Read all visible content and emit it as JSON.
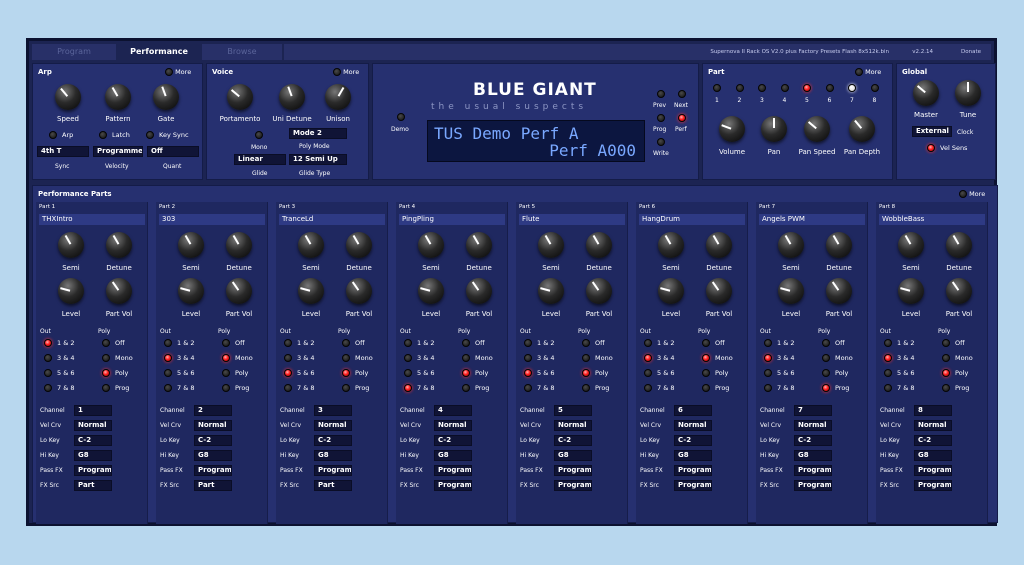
{
  "tabs": [
    "Program",
    "Performance",
    "Browse"
  ],
  "info": {
    "title": "Supernova II Rack OS V2.0 plus Factory Presets Flash 8x512k.bin",
    "version": "v2.2.14",
    "donate": "Donate"
  },
  "arp": {
    "title": "Arp",
    "more": "More",
    "knobs": [
      "Speed",
      "Pattern",
      "Gate"
    ],
    "toggles": [
      "Arp",
      "Latch",
      "Key Sync"
    ],
    "sync": "4th T",
    "sync_label": "Sync",
    "velocity": "Programmed",
    "velocity_label": "Velocity",
    "quant": "Off",
    "quant_label": "Quant"
  },
  "voice": {
    "title": "Voice",
    "more": "More",
    "knobs": [
      "Portamento",
      "Uni Detune",
      "Unison"
    ],
    "mono": "Mono",
    "poly_mode": "Mode 2",
    "poly_mode_label": "Poly Mode",
    "glide": "Linear",
    "glide_label": "Glide",
    "glide_type": "12 Semi Up",
    "glide_type_label": "Glide Type"
  },
  "display": {
    "brand": "BLUE GIANT",
    "subtitle": "the usual suspects",
    "demo": "Demo",
    "line1": "TUS Demo Perf A",
    "line2": "Perf A000",
    "prev": "Prev",
    "next": "Next",
    "prog": "Prog",
    "perf": "Perf",
    "write": "Write"
  },
  "part": {
    "title": "Part",
    "more": "More",
    "numbers": [
      "1",
      "2",
      "3",
      "4",
      "5",
      "6",
      "7",
      "8"
    ],
    "knobs": [
      "Volume",
      "Pan",
      "Pan Speed",
      "Pan Depth"
    ]
  },
  "global": {
    "title": "Global",
    "knobs": [
      "Master",
      "Tune"
    ],
    "clock_value": "External",
    "clock_label": "Clock",
    "vel_sens": "Vel Sens"
  },
  "perf_parts": {
    "title": "Performance Parts",
    "more": "More",
    "out_label": "Out",
    "poly_label": "Poly",
    "outs": [
      "1 & 2",
      "3 & 4",
      "5 & 6",
      "7 & 8"
    ],
    "polys": [
      "Off",
      "Mono",
      "Poly",
      "Prog"
    ],
    "knob_labels": [
      "Semi",
      "Detune",
      "Level",
      "Part Vol"
    ],
    "field_labels": [
      "Channel",
      "Vel Crv",
      "Lo Key",
      "Hi Key",
      "Pass FX",
      "FX Src"
    ],
    "parts": [
      {
        "hdr": "Part 1",
        "name": "THXIntro",
        "channel": "1",
        "vel": "Normal",
        "lo": "C-2",
        "hi": "G8",
        "pass": "Program (",
        "fxsrc": "Part",
        "out": 0,
        "poly": 2
      },
      {
        "hdr": "Part 2",
        "name": "303",
        "channel": "2",
        "vel": "Normal",
        "lo": "C-2",
        "hi": "G8",
        "pass": "Program (",
        "fxsrc": "Part",
        "out": 1,
        "poly": 1
      },
      {
        "hdr": "Part 3",
        "name": "TranceLd",
        "channel": "3",
        "vel": "Normal",
        "lo": "C-2",
        "hi": "G8",
        "pass": "Program (",
        "fxsrc": "Part",
        "out": 2,
        "poly": 2
      },
      {
        "hdr": "Part 4",
        "name": "PingPling",
        "channel": "4",
        "vel": "Normal",
        "lo": "C-2",
        "hi": "G8",
        "pass": "Program (",
        "fxsrc": "Program",
        "out": 3,
        "poly": 2
      },
      {
        "hdr": "Part 5",
        "name": "Flute",
        "channel": "5",
        "vel": "Normal",
        "lo": "C-2",
        "hi": "G8",
        "pass": "Program (",
        "fxsrc": "Program",
        "out": 2,
        "poly": 2
      },
      {
        "hdr": "Part 6",
        "name": "HangDrum",
        "channel": "6",
        "vel": "Normal",
        "lo": "C-2",
        "hi": "G8",
        "pass": "Program (",
        "fxsrc": "Program",
        "out": 1,
        "poly": 1
      },
      {
        "hdr": "Part 7",
        "name": "Angels PWM",
        "channel": "7",
        "vel": "Normal",
        "lo": "C-2",
        "hi": "G8",
        "pass": "Program (",
        "fxsrc": "Program",
        "out": 1,
        "poly": 3
      },
      {
        "hdr": "Part 8",
        "name": "WobbleBass",
        "channel": "8",
        "vel": "Normal",
        "lo": "C-2",
        "hi": "G8",
        "pass": "Program (",
        "fxsrc": "Program",
        "out": 1,
        "poly": 2
      }
    ]
  }
}
